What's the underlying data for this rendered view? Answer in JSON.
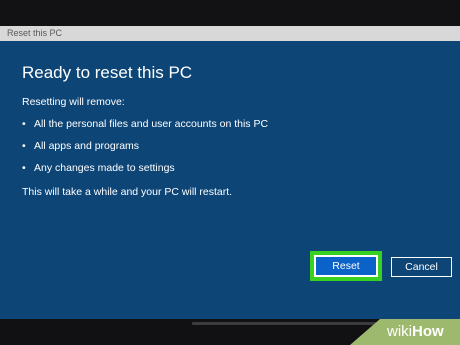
{
  "window": {
    "title": "Reset this PC"
  },
  "dialog": {
    "heading": "Ready to reset this PC",
    "intro": "Resetting will remove:",
    "items": [
      "All the personal files and user accounts on this PC",
      "All apps and programs",
      "Any changes made to settings"
    ],
    "bullet": "•",
    "note": "This will take a while and your PC will restart."
  },
  "buttons": {
    "reset_label": "Reset",
    "cancel_label": "Cancel"
  },
  "watermark": {
    "prefix": "wiki",
    "suffix": "How"
  },
  "colors": {
    "dialog_background": "#0d4577",
    "reset_button": "#0b63ca",
    "highlight": "#39d11f",
    "watermark_background": "#9db96e"
  }
}
